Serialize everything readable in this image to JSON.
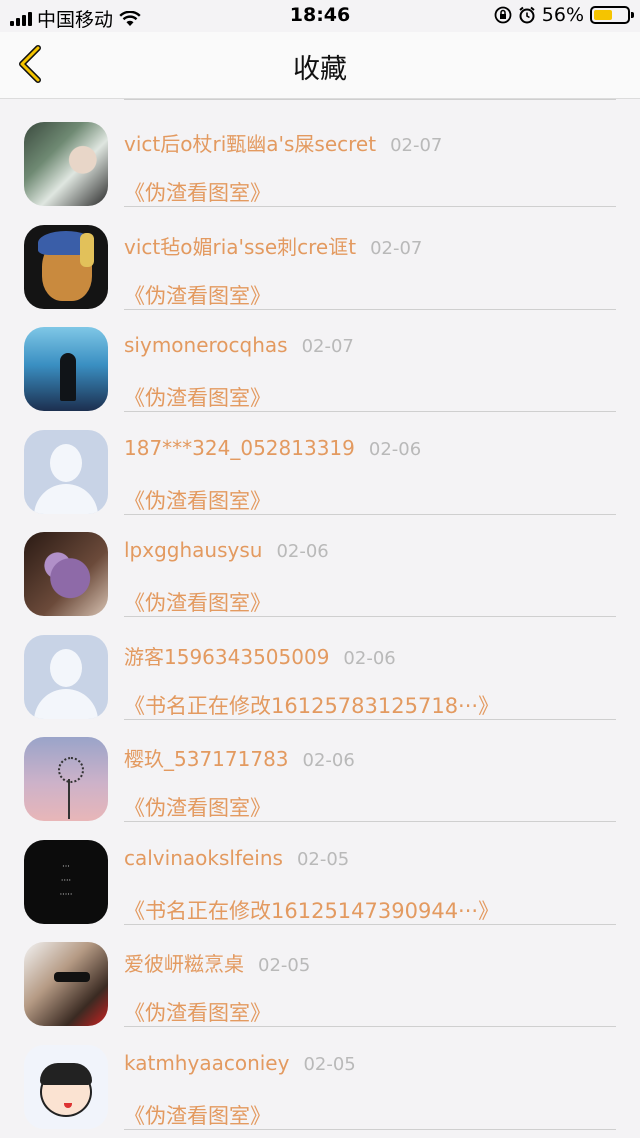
{
  "status": {
    "carrier": "中国移动",
    "time": "18:46",
    "battery": "56%",
    "battery_level": 0.56
  },
  "nav": {
    "title": "收藏"
  },
  "items": [
    {
      "name": "vict后o杖ri甄幽a's屎secret",
      "date": "02-07",
      "book": "《伪渣看图室》",
      "avatar": "photo-woman-flowers"
    },
    {
      "name": "vict毡o媚ria'sse刺cre诓t",
      "date": "02-07",
      "book": "《伪渣看图室》",
      "avatar": "doge-pearl-earring"
    },
    {
      "name": "siymonerocqhas",
      "date": "02-07",
      "book": "《伪渣看图室》",
      "avatar": "girl-waterfront"
    },
    {
      "name": "187***324_052813319",
      "date": "02-06",
      "book": "《伪渣看图室》",
      "avatar": "default-user"
    },
    {
      "name": "lpxgghausysu",
      "date": "02-06",
      "book": "《伪渣看图室》",
      "avatar": "lavender-bouquet"
    },
    {
      "name": "游客1596343505009",
      "date": "02-06",
      "book": "《书名正在修改16125783125718···》",
      "avatar": "default-user"
    },
    {
      "name": "樱玖_537171783",
      "date": "02-06",
      "book": "《伪渣看图室》",
      "avatar": "dandelion-sky"
    },
    {
      "name": "calvinaokslfeins",
      "date": "02-05",
      "book": "《书名正在修改16125147390944···》",
      "avatar": "black-text-card"
    },
    {
      "name": "爱彼岍糍烹桌",
      "date": "02-05",
      "book": "《伪渣看图室》",
      "avatar": "girl-sunglasses"
    },
    {
      "name": "katmhyaaconiey",
      "date": "02-05",
      "book": "《伪渣看图室》",
      "avatar": "cartoon-girl"
    }
  ]
}
